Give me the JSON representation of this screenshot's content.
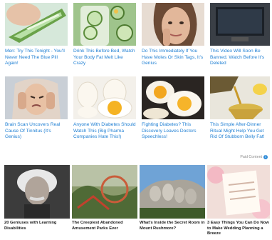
{
  "top_cards": [
    {
      "title": "Men: Try This Tonight - You'll Never Need The Blue Pill Again!",
      "icon": "aloe-leaf"
    },
    {
      "title": "Drink This Before Bed, Watch Your Body Fat Melt Like Crazy",
      "icon": "cucumber-drink"
    },
    {
      "title": "Do This Immediately If You Have Moles Or Skin Tags, It's Genius",
      "icon": "woman-face"
    },
    {
      "title": "This Video Will Soon Be Banned. Watch Before It's Deleted",
      "icon": "tv-screen"
    },
    {
      "title": "Brain Scan Uncovers Real Cause Of Tinnitus (It's Genius)",
      "icon": "woman-covering-ears"
    },
    {
      "title": "Anyone With Diabetes Should Watch This (Big Pharma Companies Hate This!)",
      "icon": "eggs"
    },
    {
      "title": "Fighting Diabetes? This Discovery Leaves Doctors Speechless!",
      "icon": "boiled-eggs"
    },
    {
      "title": "This Simple After-Dinner Ritual Might Help You Get Rid Of Stubborn Belly Fat!",
      "icon": "oil-pour"
    }
  ],
  "paid_label": "Paid Content",
  "paid_icon": "info-icon",
  "bottom_cards": [
    {
      "title": "20 Geniuses with Learning Disabilities",
      "icon": "einstein-portrait"
    },
    {
      "title": "The Creepiest Abandoned Amusement Parks Ever",
      "icon": "abandoned-park"
    },
    {
      "title": "What's Inside the Secret Room in Mount Rushmore?",
      "icon": "mount-rushmore"
    },
    {
      "title": "3 Easy Things You Can Do Now to Make Wedding Planning a Breeze",
      "icon": "wedding-checklist"
    }
  ]
}
